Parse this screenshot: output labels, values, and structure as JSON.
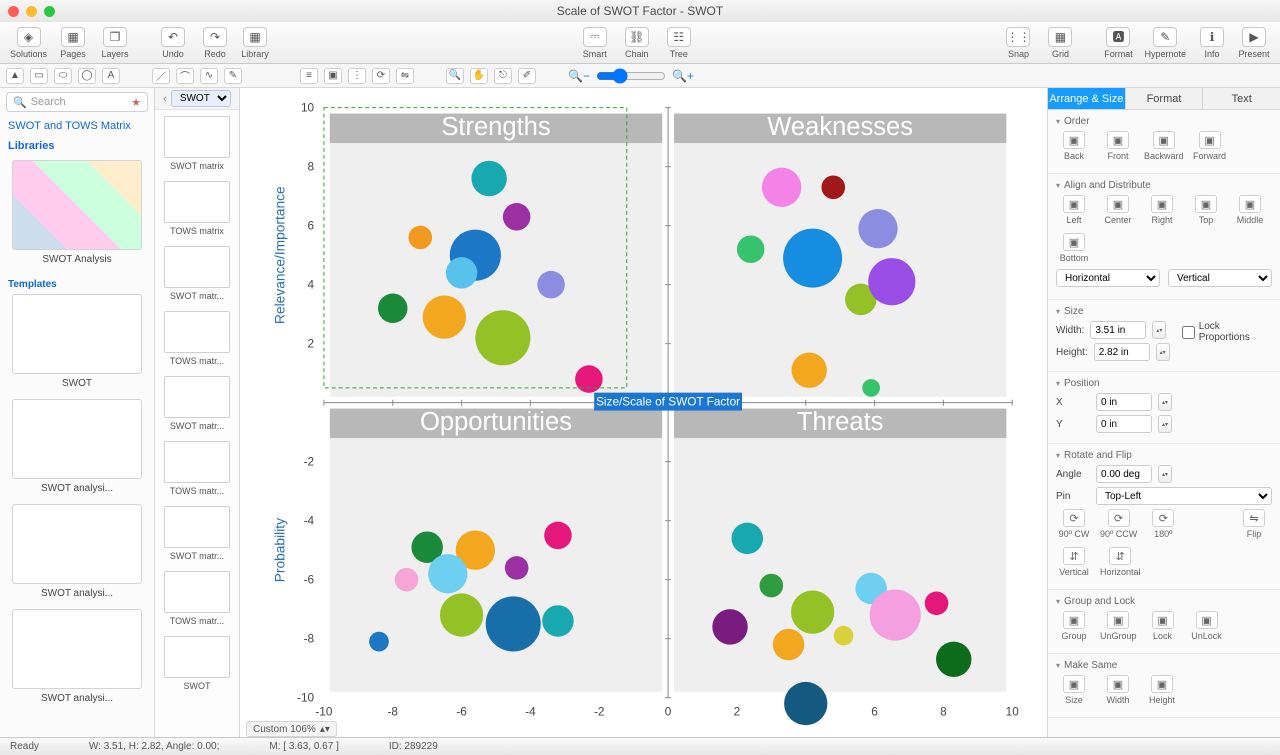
{
  "window": {
    "title": "Scale of SWOT Factor - SWOT"
  },
  "toolbar": {
    "left": [
      {
        "id": "solutions",
        "label": "Solutions",
        "icon": "◈"
      },
      {
        "id": "pages",
        "label": "Pages",
        "icon": "▦"
      },
      {
        "id": "layers",
        "label": "Layers",
        "icon": "❐"
      }
    ],
    "undo_redo": [
      {
        "id": "undo",
        "label": "Undo",
        "icon": "↶"
      },
      {
        "id": "redo",
        "label": "Redo",
        "icon": "↷"
      }
    ],
    "library": {
      "id": "library",
      "label": "Library",
      "icon": "▦"
    },
    "center": [
      {
        "id": "smart",
        "label": "Smart",
        "icon": "⎓"
      },
      {
        "id": "chain",
        "label": "Chain",
        "icon": "⛓"
      },
      {
        "id": "tree",
        "label": "Tree",
        "icon": "☷"
      }
    ],
    "right1": [
      {
        "id": "snap",
        "label": "Snap",
        "icon": "⋮⋮"
      },
      {
        "id": "grid",
        "label": "Grid",
        "icon": "▦"
      }
    ],
    "right2": [
      {
        "id": "format",
        "label": "Format",
        "icon": "🅰"
      },
      {
        "id": "hypernote",
        "label": "Hypernote",
        "icon": "✎"
      },
      {
        "id": "info",
        "label": "Info",
        "icon": "ℹ"
      },
      {
        "id": "present",
        "label": "Present",
        "icon": "▶"
      }
    ]
  },
  "libbar": {
    "selected": "SWOT"
  },
  "left1": {
    "search_placeholder": "Search",
    "sec1": "SWOT and TOWS Matrix",
    "sec2": "Libraries",
    "card1": "SWOT Analysis",
    "sec3": "Templates",
    "cards": [
      "SWOT",
      "SWOT analysi...",
      "SWOT analysi...",
      "SWOT analysi..."
    ]
  },
  "left2": {
    "items": [
      "SWOT matrix",
      "TOWS matrix",
      "SWOT matr...",
      "TOWS matr...",
      "SWOT matr...",
      "TOWS matr...",
      "SWOT matr...",
      "TOWS matr...",
      "SWOT"
    ]
  },
  "chart_data": {
    "type": "scatter",
    "title_q1": "Strengths",
    "title_q2": "Weaknesses",
    "title_q3": "Opportunities",
    "title_q4": "Threats",
    "xlabel": "Size/Scale of SWOT Factor",
    "ylabel_top": "Relevance/Importance",
    "ylabel_bot": "Probability",
    "xlim": [
      -10,
      10
    ],
    "ylim": [
      -10,
      10
    ],
    "xticks": [
      -10,
      -8,
      -6,
      -4,
      -2,
      0,
      2,
      4,
      6,
      8,
      10
    ],
    "yticks": [
      -10,
      -8,
      -6,
      -4,
      -2,
      2,
      4,
      6,
      8,
      10
    ],
    "bubbles": [
      {
        "x": -7.2,
        "y": 5.6,
        "r": 12,
        "c": "#f29a1f"
      },
      {
        "x": -8.0,
        "y": 3.2,
        "r": 15,
        "c": "#1a8a3a"
      },
      {
        "x": -6.5,
        "y": 2.9,
        "r": 22,
        "c": "#f2a71f"
      },
      {
        "x": -5.2,
        "y": 7.6,
        "r": 18,
        "c": "#17a8b0"
      },
      {
        "x": -5.6,
        "y": 5.0,
        "r": 26,
        "c": "#1c78c6"
      },
      {
        "x": -4.4,
        "y": 6.3,
        "r": 14,
        "c": "#9c2fa1"
      },
      {
        "x": -4.8,
        "y": 2.2,
        "r": 28,
        "c": "#94c125"
      },
      {
        "x": -3.4,
        "y": 4.0,
        "r": 14,
        "c": "#8a8de0"
      },
      {
        "x": -6.0,
        "y": 4.4,
        "r": 16,
        "c": "#57c3ec"
      },
      {
        "x": -2.3,
        "y": 0.8,
        "r": 14,
        "c": "#e6177a"
      },
      {
        "x": 2.4,
        "y": 5.2,
        "r": 14,
        "c": "#37c26c"
      },
      {
        "x": 3.3,
        "y": 7.3,
        "r": 20,
        "c": "#f582e6"
      },
      {
        "x": 4.8,
        "y": 7.3,
        "r": 12,
        "c": "#a01818"
      },
      {
        "x": 4.2,
        "y": 4.9,
        "r": 30,
        "c": "#168de0"
      },
      {
        "x": 5.6,
        "y": 3.5,
        "r": 16,
        "c": "#94c125"
      },
      {
        "x": 6.5,
        "y": 4.1,
        "r": 24,
        "c": "#9a4de6"
      },
      {
        "x": 6.1,
        "y": 5.9,
        "r": 20,
        "c": "#8a8de0"
      },
      {
        "x": 4.1,
        "y": 1.1,
        "r": 18,
        "c": "#f2a71f"
      },
      {
        "x": 5.9,
        "y": 0.5,
        "r": 9,
        "c": "#37c26c"
      },
      {
        "x": -8.4,
        "y": -8.1,
        "r": 10,
        "c": "#1c78c6"
      },
      {
        "x": -7.6,
        "y": -6.0,
        "r": 12,
        "c": "#f5a6d7"
      },
      {
        "x": -7.0,
        "y": -4.9,
        "r": 16,
        "c": "#1a8a3a"
      },
      {
        "x": -6.0,
        "y": -7.2,
        "r": 22,
        "c": "#94c125"
      },
      {
        "x": -5.6,
        "y": -5.0,
        "r": 20,
        "c": "#f2a71f"
      },
      {
        "x": -6.4,
        "y": -5.8,
        "r": 20,
        "c": "#6fcff0"
      },
      {
        "x": -4.5,
        "y": -7.5,
        "r": 28,
        "c": "#186ea8"
      },
      {
        "x": -4.4,
        "y": -5.6,
        "r": 12,
        "c": "#9c2fa1"
      },
      {
        "x": -3.2,
        "y": -7.4,
        "r": 16,
        "c": "#17a8b0"
      },
      {
        "x": -3.2,
        "y": -4.5,
        "r": 14,
        "c": "#e6177a"
      },
      {
        "x": 2.3,
        "y": -4.6,
        "r": 16,
        "c": "#17a8b0"
      },
      {
        "x": 1.8,
        "y": -7.6,
        "r": 18,
        "c": "#7a1b80"
      },
      {
        "x": 3.0,
        "y": -6.2,
        "r": 12,
        "c": "#2e9c3f"
      },
      {
        "x": 3.5,
        "y": -8.2,
        "r": 16,
        "c": "#f2a71f"
      },
      {
        "x": 4.2,
        "y": -7.1,
        "r": 22,
        "c": "#94c125"
      },
      {
        "x": 4.0,
        "y": -10.2,
        "r": 22,
        "c": "#14597f"
      },
      {
        "x": 5.1,
        "y": -7.9,
        "r": 10,
        "c": "#d9d13a"
      },
      {
        "x": 5.9,
        "y": -6.3,
        "r": 16,
        "c": "#6fcff0"
      },
      {
        "x": 6.6,
        "y": -7.2,
        "r": 26,
        "c": "#f59fe0"
      },
      {
        "x": 7.8,
        "y": -6.8,
        "r": 12,
        "c": "#e6177a"
      },
      {
        "x": 8.3,
        "y": -8.7,
        "r": 18,
        "c": "#0d6b1c"
      }
    ],
    "selection": {
      "x0": -10,
      "y0": 0.5,
      "x1": -1.2,
      "y1": 10
    }
  },
  "inspector": {
    "tabs": [
      "Arrange & Size",
      "Format",
      "Text"
    ],
    "active_tab": 0,
    "order": {
      "title": "Order",
      "items": [
        "Back",
        "Front",
        "Backward",
        "Forward"
      ]
    },
    "align": {
      "title": "Align and Distribute",
      "h": [
        "Left",
        "Center",
        "Right"
      ],
      "v": [
        "Top",
        "Middle",
        "Bottom"
      ],
      "hsel": "Horizontal",
      "vsel": "Vertical"
    },
    "size": {
      "title": "Size",
      "w_label": "Width:",
      "w": "3.51 in",
      "h_label": "Height:",
      "h": "2.82 in",
      "lock": "Lock Proportions"
    },
    "pos": {
      "title": "Position",
      "x_label": "X",
      "x": "0 in",
      "y_label": "Y",
      "y": "0 in"
    },
    "rot": {
      "title": "Rotate and Flip",
      "angle_label": "Angle",
      "angle": "0.00 deg",
      "pin_label": "Pin",
      "pin": "Top-Left",
      "btns": [
        "90º CW",
        "90º CCW",
        "180º"
      ],
      "flip_label": "Flip",
      "flip": [
        "Vertical",
        "Horizontal"
      ]
    },
    "grp": {
      "title": "Group and Lock",
      "items": [
        "Group",
        "UnGroup",
        "Lock",
        "UnLock"
      ]
    },
    "same": {
      "title": "Make Same",
      "items": [
        "Size",
        "Width",
        "Height"
      ]
    }
  },
  "status": {
    "ready": "Ready",
    "wh": "W: 3.51,  H: 2.82,  Angle: 0.00;",
    "m": "M: [ 3.63, 0.67 ]",
    "id": "ID: 289229",
    "zoom": "Custom 106%"
  }
}
